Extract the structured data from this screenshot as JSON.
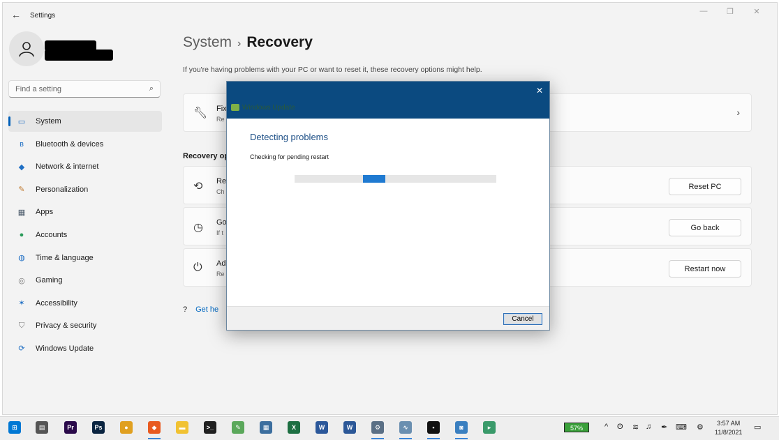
{
  "window": {
    "title": "Settings",
    "min_glyph": "—",
    "max_glyph": "❐",
    "close_glyph": "✕"
  },
  "search": {
    "placeholder": "Find a setting"
  },
  "nav": [
    {
      "label": "System",
      "icon": "monitor-icon",
      "active": true
    },
    {
      "label": "Bluetooth & devices",
      "icon": "bluetooth-icon"
    },
    {
      "label": "Network & internet",
      "icon": "wifi-icon"
    },
    {
      "label": "Personalization",
      "icon": "brush-icon"
    },
    {
      "label": "Apps",
      "icon": "apps-icon"
    },
    {
      "label": "Accounts",
      "icon": "person-icon"
    },
    {
      "label": "Time & language",
      "icon": "globe-clock-icon"
    },
    {
      "label": "Gaming",
      "icon": "gamepad-icon"
    },
    {
      "label": "Accessibility",
      "icon": "accessibility-icon"
    },
    {
      "label": "Privacy & security",
      "icon": "shield-icon"
    },
    {
      "label": "Windows Update",
      "icon": "update-icon"
    }
  ],
  "breadcrumb": {
    "parent": "System",
    "separator": "›",
    "current": "Recovery"
  },
  "intro": "If you're having problems with your PC or want to reset it, these recovery options might help.",
  "fix_card": {
    "title": "Fix",
    "subtitle": "Re",
    "chevron": "›"
  },
  "section_label": "Recovery op",
  "recovery_cards": [
    {
      "title": "Re",
      "subtitle": "Ch",
      "button": "Reset PC",
      "icon": "reset-pc-icon"
    },
    {
      "title": "Go",
      "subtitle": "If t",
      "button": "Go back",
      "icon": "history-icon"
    },
    {
      "title": "Ad",
      "subtitle": "Re",
      "button": "Restart now",
      "icon": "advanced-startup-icon"
    }
  ],
  "get_help": "Get he",
  "dialog": {
    "close_glyph": "✕",
    "app_title": "Windows Update",
    "heading": "Detecting problems",
    "status": "Checking for pending restart",
    "cancel": "Cancel"
  },
  "taskbar": {
    "battery": "57%",
    "time": "3:57 AM",
    "date": "11/8/2021",
    "apps": [
      {
        "name": "start-icon",
        "color": "#0078d4",
        "glyph": "⊞"
      },
      {
        "name": "task-view-icon",
        "color": "#555555",
        "glyph": "▤"
      },
      {
        "name": "premiere-icon",
        "color": "#2a0a4a",
        "glyph": "Pr"
      },
      {
        "name": "photoshop-icon",
        "color": "#0a2440",
        "glyph": "Ps"
      },
      {
        "name": "chrome-icon",
        "color": "#e0a020",
        "glyph": "●"
      },
      {
        "name": "brave-icon",
        "color": "#e85a20",
        "glyph": "◆"
      },
      {
        "name": "file-explorer-icon",
        "color": "#f1c232",
        "glyph": "▬"
      },
      {
        "name": "terminal-icon",
        "color": "#202020",
        "glyph": ">_"
      },
      {
        "name": "notepad-icon",
        "color": "#5ba85b",
        "glyph": "✎"
      },
      {
        "name": "calculator-icon",
        "color": "#3c6e9e",
        "glyph": "▦"
      },
      {
        "name": "excel-icon",
        "color": "#1d6f42",
        "glyph": "X"
      },
      {
        "name": "word-icon",
        "color": "#2b579a",
        "glyph": "W"
      },
      {
        "name": "wordpad-icon",
        "color": "#2b5797",
        "glyph": "W"
      },
      {
        "name": "settings-icon",
        "color": "#5a6f85",
        "glyph": "⚙"
      },
      {
        "name": "resource-monitor-icon",
        "color": "#6a8fb0",
        "glyph": "∿"
      },
      {
        "name": "command-prompt-icon",
        "color": "#111111",
        "glyph": "▪"
      },
      {
        "name": "control-panel-icon",
        "color": "#3a7fc0",
        "glyph": "◙"
      },
      {
        "name": "troubleshooter-icon",
        "color": "#3a9a6a",
        "glyph": "▸"
      }
    ]
  }
}
